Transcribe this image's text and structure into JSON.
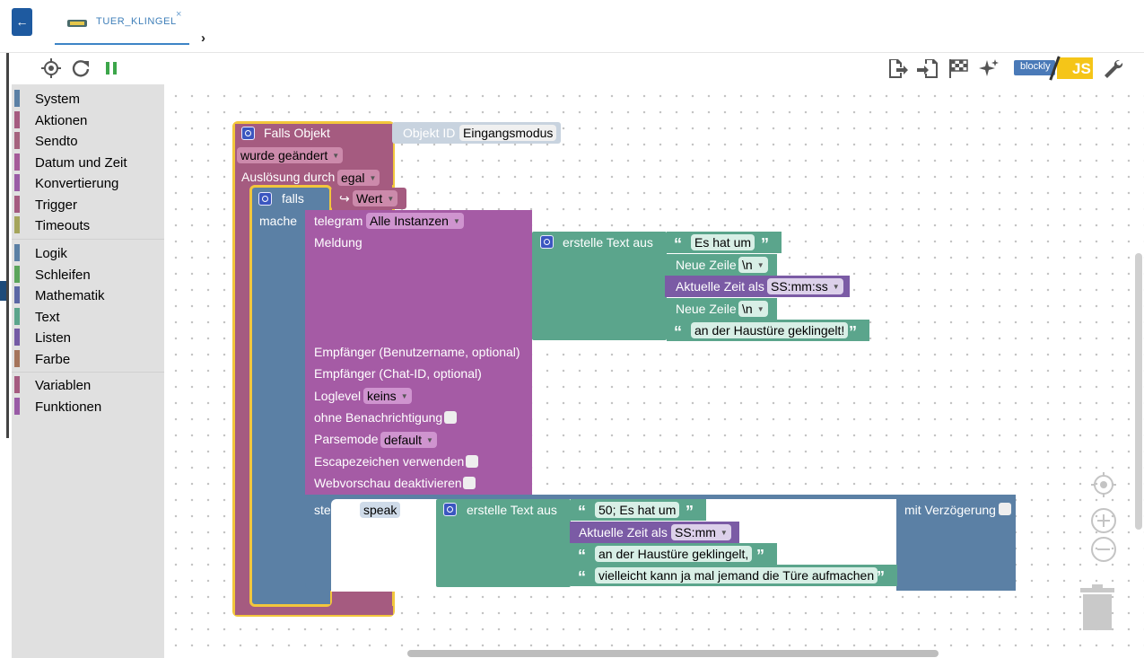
{
  "header": {
    "tab_label": "TUER_KLINGEL",
    "close_glyph": "×",
    "back_glyph": "←",
    "next_glyph": "›"
  },
  "toolbar": {
    "blockly_label": "blockly",
    "js_label": "JS",
    "icons": [
      "crosshair-icon",
      "refresh-icon",
      "pause-icon",
      "export-icon",
      "import-icon",
      "checkered-flag-icon",
      "sparkle-icon",
      "blockly-js-toggle",
      "wrench-icon"
    ]
  },
  "sidebar": {
    "groups": [
      [
        {
          "label": "System",
          "color": "#5b80a5"
        },
        {
          "label": "Aktionen",
          "color": "#a55b80"
        },
        {
          "label": "Sendto",
          "color": "#a5637e"
        },
        {
          "label": "Datum und Zeit",
          "color": "#a55b99"
        },
        {
          "label": "Konvertierung",
          "color": "#9a5ca6"
        },
        {
          "label": "Trigger",
          "color": "#a55b80"
        },
        {
          "label": "Timeouts",
          "color": "#a5a55b"
        }
      ],
      [
        {
          "label": "Logik",
          "color": "#5b80a5"
        },
        {
          "label": "Schleifen",
          "color": "#5ba55b"
        },
        {
          "label": "Mathematik",
          "color": "#5b67a5"
        },
        {
          "label": "Text",
          "color": "#5ba58c"
        },
        {
          "label": "Listen",
          "color": "#745ba5"
        },
        {
          "label": "Farbe",
          "color": "#a5745b"
        }
      ],
      [
        {
          "label": "Variablen",
          "color": "#a55b80"
        },
        {
          "label": "Funktionen",
          "color": "#995ba6"
        }
      ]
    ]
  },
  "blocks": {
    "falls_objekt": "Falls Objekt",
    "objekt_id_label": "Objekt ID",
    "objekt_id_value": "Eingangsmodus",
    "wurde_geaendert": "wurde geändert",
    "ausloesung_label": "Auslösung durch",
    "ausloesung_value": "egal",
    "falls": "falls",
    "wert": "Wert",
    "wert_icon": "↪",
    "mache": "mache",
    "telegram": "telegram",
    "telegram_instance": "Alle Instanzen",
    "meldung": "Meldung",
    "erstelle_text": "erstelle Text aus",
    "text1": "Es hat um",
    "neue_zeile": "Neue Zeile",
    "newline_value": "\\n",
    "aktuelle_zeit": "Aktuelle Zeit als",
    "time_format1": "SS:mm:ss",
    "text2": "an der Haustüre geklingelt!",
    "empfaenger_name": "Empfänger (Benutzername, optional)",
    "empfaenger_chat": "Empfänger (Chat-ID, optional)",
    "loglevel": "Loglevel",
    "loglevel_value": "keins",
    "ohne_benachrichtigung": "ohne Benachrichtigung",
    "parsemode": "Parsemode",
    "parsemode_value": "default",
    "escapezeichen": "Escapezeichen verwenden",
    "webvorschau": "Webvorschau deaktivieren",
    "steuere": "steuere",
    "speak": "speak",
    "mit": "mit",
    "mit_verzoegerung": "mit Verzögerung",
    "text3": "50; Es hat um",
    "time_format2": "SS:mm",
    "text4": "an der Haustüre geklingelt,",
    "text5": "vielleicht kann ja mal jemand die Türe aufmachen",
    "quote_open": "“",
    "quote_close": "”"
  },
  "colors": {
    "event": "#a55b80",
    "telegram": "#a55ba5",
    "logic": "#5b80a5",
    "text": "#5ba58c",
    "time": "#7b5ba5",
    "highlight": "#f2c63c"
  }
}
